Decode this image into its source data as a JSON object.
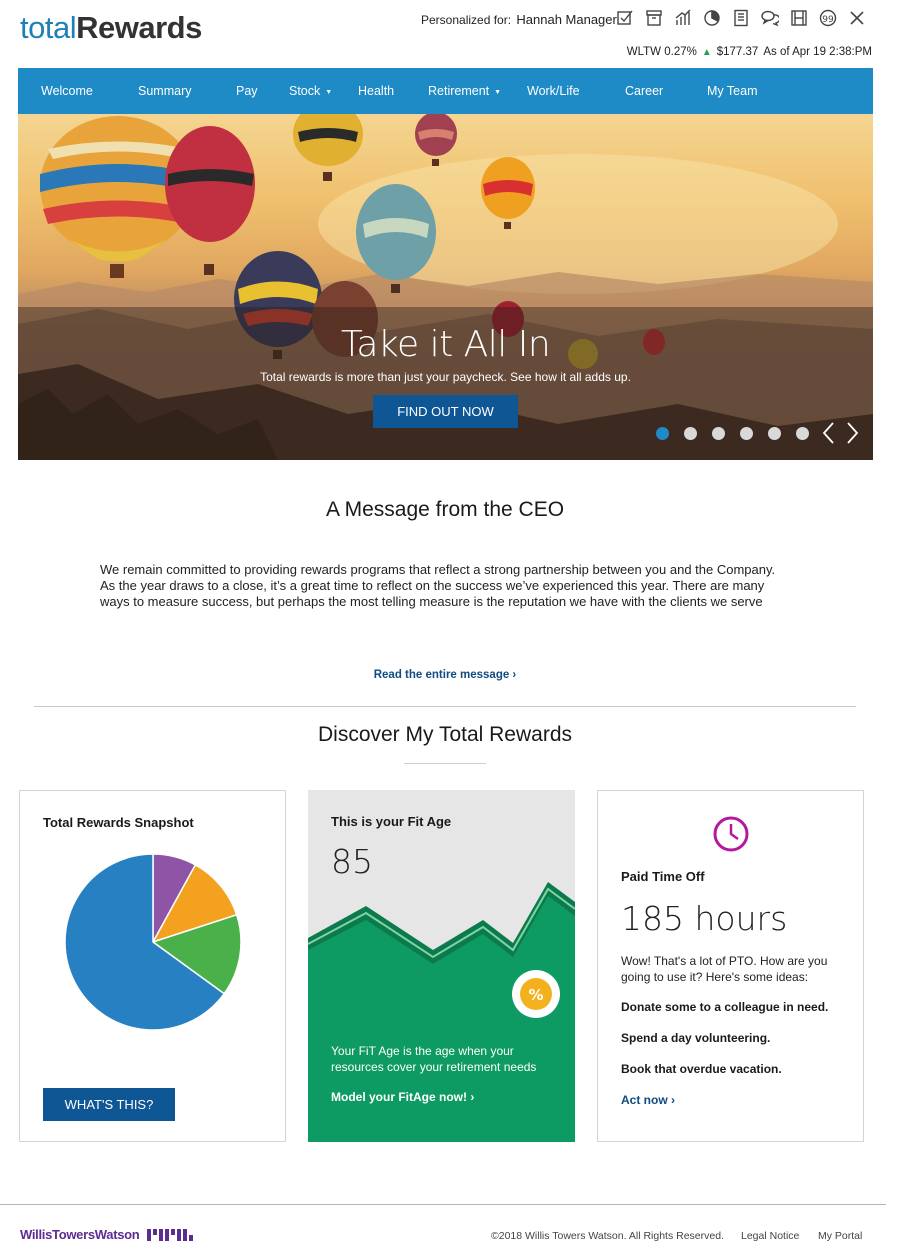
{
  "header": {
    "logo_part1": "total",
    "logo_part2": "Rewards",
    "personalized_label": "Personalized for:",
    "user_name": "Hannah Manager",
    "icons": [
      "checklist-icon",
      "archive-icon",
      "bar-chart-icon",
      "pie-chart-icon",
      "document-icon",
      "chat-icon",
      "film-icon",
      "quote-icon",
      "close-icon"
    ],
    "ticker_symbol": "WLTW 0.27%",
    "ticker_price": "$177.37",
    "ticker_time": "As of Apr 19 2:38:PM"
  },
  "nav": {
    "items": [
      {
        "label": "Welcome",
        "caret": false
      },
      {
        "label": "Summary",
        "caret": false
      },
      {
        "label": "Pay",
        "caret": false
      },
      {
        "label": "Stock",
        "caret": true
      },
      {
        "label": "Health",
        "caret": false
      },
      {
        "label": "Retirement",
        "caret": true
      },
      {
        "label": "Work/Life",
        "caret": false
      },
      {
        "label": "Career",
        "caret": false
      },
      {
        "label": "My Team",
        "caret": false
      }
    ]
  },
  "hero": {
    "title": "Take it All In",
    "subtitle": "Total rewards is more than just your paycheck. See how it all adds up.",
    "button": "FIND OUT NOW",
    "slide_count": 6,
    "active_slide": 0
  },
  "ceo": {
    "title": "A Message from the CEO",
    "text": "We remain committed to providing rewards programs that reflect a strong partnership between you and the Company. As the year draws to a close, it’s a great time to reflect on the success we’ve experienced this year. There are many ways to measure success, but perhaps the most telling measure is the reputation we have with the clients we serve",
    "link": "Read the entire message ›"
  },
  "discover": {
    "title": "Discover My Total Rewards"
  },
  "cards": {
    "snapshot": {
      "title": "Total Rewards Snapshot",
      "button": "WHAT'S THIS?",
      "slices": [
        {
          "value": 8,
          "color": "#8e55a6"
        },
        {
          "value": 12,
          "color": "#f4a11f"
        },
        {
          "value": 15,
          "color": "#4ab04a"
        },
        {
          "value": 65,
          "color": "#2680c2"
        }
      ]
    },
    "fitage": {
      "title": "This is your Fit Age",
      "value": "85",
      "text": "Your FiT Age is the age when your resources cover your retirement needs",
      "link": "Model your FitAge now! ›",
      "badge_icon": "percent-icon"
    },
    "pto": {
      "title": "Paid Time Off",
      "hours": "185 hours",
      "text": "Wow! That's a lot of PTO. How are you going to use it? Here's some ideas:",
      "ideas": [
        "Donate some to a colleague in need.",
        "Spend a day volunteering.",
        "Book that overdue vacation."
      ],
      "link": "Act now ›",
      "icon": "clock-icon"
    }
  },
  "footer": {
    "brand": "WillisTowersWatson",
    "copyright": "©2018 Willis Towers Watson. All Rights Reserved.",
    "legal": "Legal Notice",
    "portal": "My Portal"
  },
  "colors": {
    "nav_blue": "#1f8bc6",
    "button_blue": "#0f5694",
    "fit_green": "#0d9a63",
    "pto_magenta": "#b5179e",
    "brand_purple": "#5c2d91"
  }
}
